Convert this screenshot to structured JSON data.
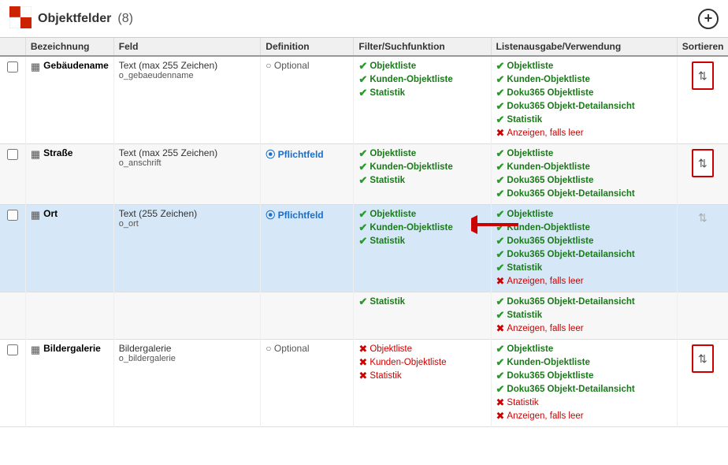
{
  "header": {
    "title": "Objektfelder",
    "count": "(8)",
    "add_label": "+"
  },
  "table": {
    "columns": [
      {
        "id": "check",
        "label": ""
      },
      {
        "id": "bezeichnung",
        "label": "Bezeichnung"
      },
      {
        "id": "feld",
        "label": "Feld"
      },
      {
        "id": "definition",
        "label": "Definition"
      },
      {
        "id": "filter",
        "label": "Filter/Suchfunktion"
      },
      {
        "id": "liste",
        "label": "Listenausgabe/Verwendung"
      },
      {
        "id": "sortieren",
        "label": "Sortieren"
      }
    ],
    "rows": [
      {
        "id": "gebaeudenname",
        "bezeichnung": "Gebäudename",
        "feld_type": "Text (max 255 Zeichen)",
        "feld_name": "o_gebaeudenname",
        "definition_type": "optional",
        "definition_label": "Optional",
        "filter_tags": [
          {
            "type": "green",
            "label": "Objektliste"
          },
          {
            "type": "green",
            "label": "Kunden-Objektliste"
          },
          {
            "type": "green",
            "label": "Statistik"
          }
        ],
        "liste_tags": [
          {
            "type": "green",
            "label": "Objektliste"
          },
          {
            "type": "green",
            "label": "Kunden-Objektliste"
          },
          {
            "type": "green",
            "label": "Doku365 Objektliste"
          },
          {
            "type": "green",
            "label": "Doku365 Objekt-Detailansicht"
          },
          {
            "type": "green",
            "label": "Statistik"
          },
          {
            "type": "red",
            "label": "Anzeigen, falls leer"
          }
        ],
        "has_sort": true,
        "highlighted": false
      },
      {
        "id": "strasse",
        "bezeichnung": "Straße",
        "feld_type": "Text (max 255 Zeichen)",
        "feld_name": "o_anschrift",
        "definition_type": "pflichtfeld",
        "definition_label": "Pflichtfeld",
        "filter_tags": [
          {
            "type": "green",
            "label": "Objektliste"
          },
          {
            "type": "green",
            "label": "Kunden-Objektliste"
          },
          {
            "type": "green",
            "label": "Statistik"
          }
        ],
        "liste_tags": [
          {
            "type": "green",
            "label": "Objektliste"
          },
          {
            "type": "green",
            "label": "Kunden-Objektliste"
          },
          {
            "type": "green",
            "label": "Doku365 Objektliste"
          },
          {
            "type": "green",
            "label": "Doku365 Objekt-Detailansicht"
          }
        ],
        "has_sort": true,
        "highlighted": false
      },
      {
        "id": "ort",
        "bezeichnung": "Ort",
        "feld_type": "Text (255 Zeichen)",
        "feld_name": "o_ort",
        "definition_type": "pflichtfeld",
        "definition_label": "Pflichtfeld",
        "filter_tags": [
          {
            "type": "green",
            "label": "Objektliste"
          },
          {
            "type": "green",
            "label": "Kunden-Objektliste"
          },
          {
            "type": "green",
            "label": "Statistik"
          }
        ],
        "liste_tags": [
          {
            "type": "green",
            "label": "Objektliste"
          },
          {
            "type": "green",
            "label": "Kunden-Objektliste"
          },
          {
            "type": "green",
            "label": "Doku365 Objektliste"
          },
          {
            "type": "green",
            "label": "Doku365 Objekt-Detailansicht"
          },
          {
            "type": "green",
            "label": "Statistik"
          },
          {
            "type": "red",
            "label": "Anzeigen, falls leer"
          }
        ],
        "has_sort": false,
        "highlighted": true,
        "has_red_arrow": true
      },
      {
        "id": "partial",
        "bezeichnung": "",
        "feld_type": "",
        "feld_name": "",
        "definition_type": "",
        "definition_label": "",
        "filter_tags": [
          {
            "type": "green",
            "label": "Statistik"
          }
        ],
        "liste_tags": [
          {
            "type": "green",
            "label": "Doku365 Objekt-Detailansicht"
          },
          {
            "type": "green",
            "label": "Statistik"
          },
          {
            "type": "red",
            "label": "Anzeigen, falls leer"
          }
        ],
        "has_sort": false,
        "highlighted": false,
        "is_partial": true
      },
      {
        "id": "bildergalerie",
        "bezeichnung": "Bildergalerie",
        "feld_type": "Bildergalerie",
        "feld_name": "o_bildergalerie",
        "definition_type": "optional",
        "definition_label": "Optional",
        "filter_tags": [
          {
            "type": "red",
            "label": "Objektliste"
          },
          {
            "type": "red",
            "label": "Kunden-Objektliste"
          },
          {
            "type": "red",
            "label": "Statistik"
          }
        ],
        "liste_tags": [
          {
            "type": "green",
            "label": "Objektliste"
          },
          {
            "type": "green",
            "label": "Kunden-Objektliste"
          },
          {
            "type": "green",
            "label": "Doku365 Objektliste"
          },
          {
            "type": "green",
            "label": "Doku365 Objekt-Detailansicht"
          },
          {
            "type": "red",
            "label": "Statistik"
          },
          {
            "type": "red",
            "label": "Anzeigen, falls leer"
          }
        ],
        "has_sort": true,
        "highlighted": false
      }
    ]
  }
}
